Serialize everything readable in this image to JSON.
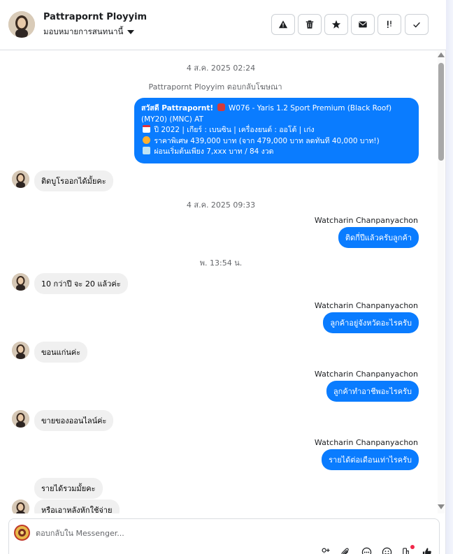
{
  "header": {
    "contact_name": "Pattrapornt Ployyim",
    "assign_label": "มอบหมายการสนทนานี้",
    "actions": [
      "alert-icon",
      "trash-icon",
      "star-icon",
      "mail-icon",
      "follow-up-icon",
      "check-icon"
    ]
  },
  "chat": {
    "ts1": "4 ส.ค. 2025 02:24",
    "system_reply": "Pattrapornt Ployyim ตอบกลับโฆษณา",
    "ad_message": {
      "line1_greeting": "สวัสดี Pattrapornt!",
      "line1_rest": "W076 - Yaris 1.2 Sport Premium (Black Roof) (MY20) (MNC) AT",
      "line2": "ปี 2022 | เกียร์ : เบนซิน | เครื่องยนต์ : ออโต้ | เก่ง",
      "line3": "ราคาพิเศษ 439,000 บาท (จาก 479,000 บาท ลดทันที 40,000 บาท!)",
      "line4": "ผ่อนเริ่มต้นเพียง 7,xxx บาท / 84 งวด"
    },
    "in1": "ติดบูโรออกได้มั้ยคะ",
    "ts2": "4 ส.ค. 2025 09:33",
    "agent_name": "Watcharin Chanpanyachon",
    "out1": "ติดกี่ปีแล้วครับลูกค้า",
    "ts3": "พ. 13:54 น.",
    "in2": "10 กว่าปี จะ 20 แล้วค่ะ",
    "out2": "ลูกค้าอยู่จังหวัดอะไรครับ",
    "in3": "ขอนแก่นค่ะ",
    "out3": "ลูกค้าทำอาชีพอะไรครับ",
    "in4": "ขายของออนไลน์ค่ะ",
    "out4": "รายได้ต่อเดือนเท่าไรครับ",
    "in5": "รายได้รวมมั้ยคะ",
    "in6": "หรือเอาหลังหักใช้จ่าย"
  },
  "composer": {
    "placeholder": "ตอบกลับใน Messenger...",
    "tools": [
      "add-person-icon",
      "attachment-icon",
      "more-icon",
      "emoji-icon",
      "apps-icon",
      "like-icon"
    ]
  },
  "colors": {
    "outgoing_bubble": "#0a7cff",
    "incoming_bubble": "#f0f0f0",
    "notification_dot": "#f02849"
  }
}
